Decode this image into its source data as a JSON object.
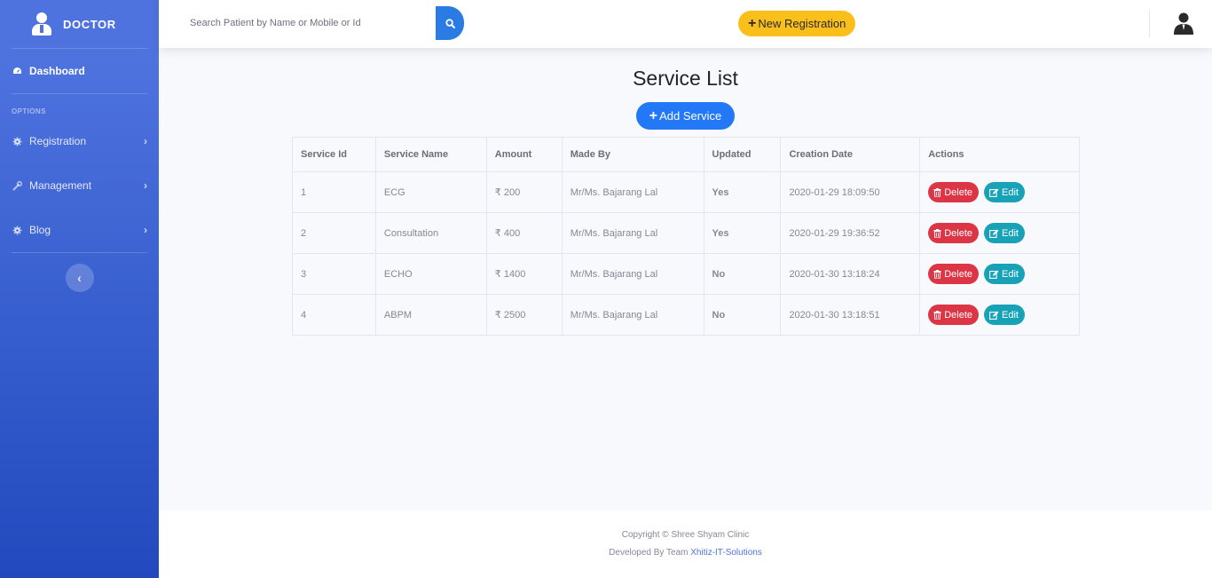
{
  "sidebar": {
    "brand": "DOCTOR",
    "dashboard": "Dashboard",
    "heading": "OPTIONS",
    "items": [
      {
        "label": "Registration",
        "icon": "cog-icon"
      },
      {
        "label": "Management",
        "icon": "wrench-icon"
      },
      {
        "label": "Blog",
        "icon": "cog-icon"
      }
    ]
  },
  "topbar": {
    "search_placeholder": "Search Patient by Name or Mobile or Id",
    "new_registration": "New Registration"
  },
  "main": {
    "title": "Service List",
    "add_service": "Add Service",
    "columns": [
      "Service Id",
      "Service Name",
      "Amount",
      "Made By",
      "Updated",
      "Creation Date",
      "Actions"
    ],
    "rows": [
      {
        "id": "1",
        "name": "ECG",
        "amount": "₹ 200",
        "made_by": "Mr/Ms. Bajarang Lal",
        "updated": "Yes",
        "date": "2020-01-29 18:09:50"
      },
      {
        "id": "2",
        "name": "Consultation",
        "amount": "₹ 400",
        "made_by": "Mr/Ms. Bajarang Lal",
        "updated": "Yes",
        "date": "2020-01-29 19:36:52"
      },
      {
        "id": "3",
        "name": "ECHO",
        "amount": "₹ 1400",
        "made_by": "Mr/Ms. Bajarang Lal",
        "updated": "No",
        "date": "2020-01-30 13:18:24"
      },
      {
        "id": "4",
        "name": "ABPM",
        "amount": "₹ 2500",
        "made_by": "Mr/Ms. Bajarang Lal",
        "updated": "No",
        "date": "2020-01-30 13:18:51"
      }
    ],
    "delete_label": "Delete",
    "edit_label": "Edit"
  },
  "footer": {
    "copyright": "Copyright © Shree Shyam Clinic",
    "developed_by": "Developed By Team",
    "team": "Xhitiz-IT-Solutions"
  },
  "colors": {
    "sidebar_top": "#4e73df",
    "sidebar_bottom": "#224abe",
    "primary": "#2378f7",
    "warning": "#fbbf1c",
    "danger": "#dc3545",
    "info": "#17a2b8",
    "success": "#1f9d4a"
  }
}
